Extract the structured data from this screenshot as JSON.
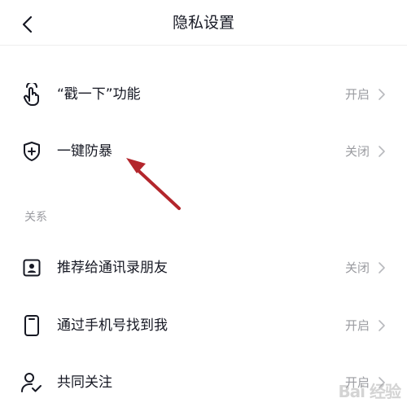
{
  "header": {
    "title": "隐私设置"
  },
  "top_items": [
    {
      "label": "“戳一下”功能",
      "status": "开启",
      "icon": "tap-finger-icon"
    },
    {
      "label": "一键防暴",
      "status": "关闭",
      "icon": "shield-plus-icon"
    }
  ],
  "section": {
    "title": "关系"
  },
  "relation_items": [
    {
      "label": "推荐给通讯录朋友",
      "status": "关闭",
      "icon": "contact-card-icon"
    },
    {
      "label": "通过手机号找到我",
      "status": "开启",
      "icon": "phone-icon"
    },
    {
      "label": "共同关注",
      "status": "开启",
      "icon": "user-check-icon"
    }
  ],
  "colors": {
    "text_primary": "#161823",
    "text_secondary": "#9a9ba0",
    "annotation_arrow": "#b3262c"
  },
  "watermark": {
    "text": "Bai 经验"
  }
}
